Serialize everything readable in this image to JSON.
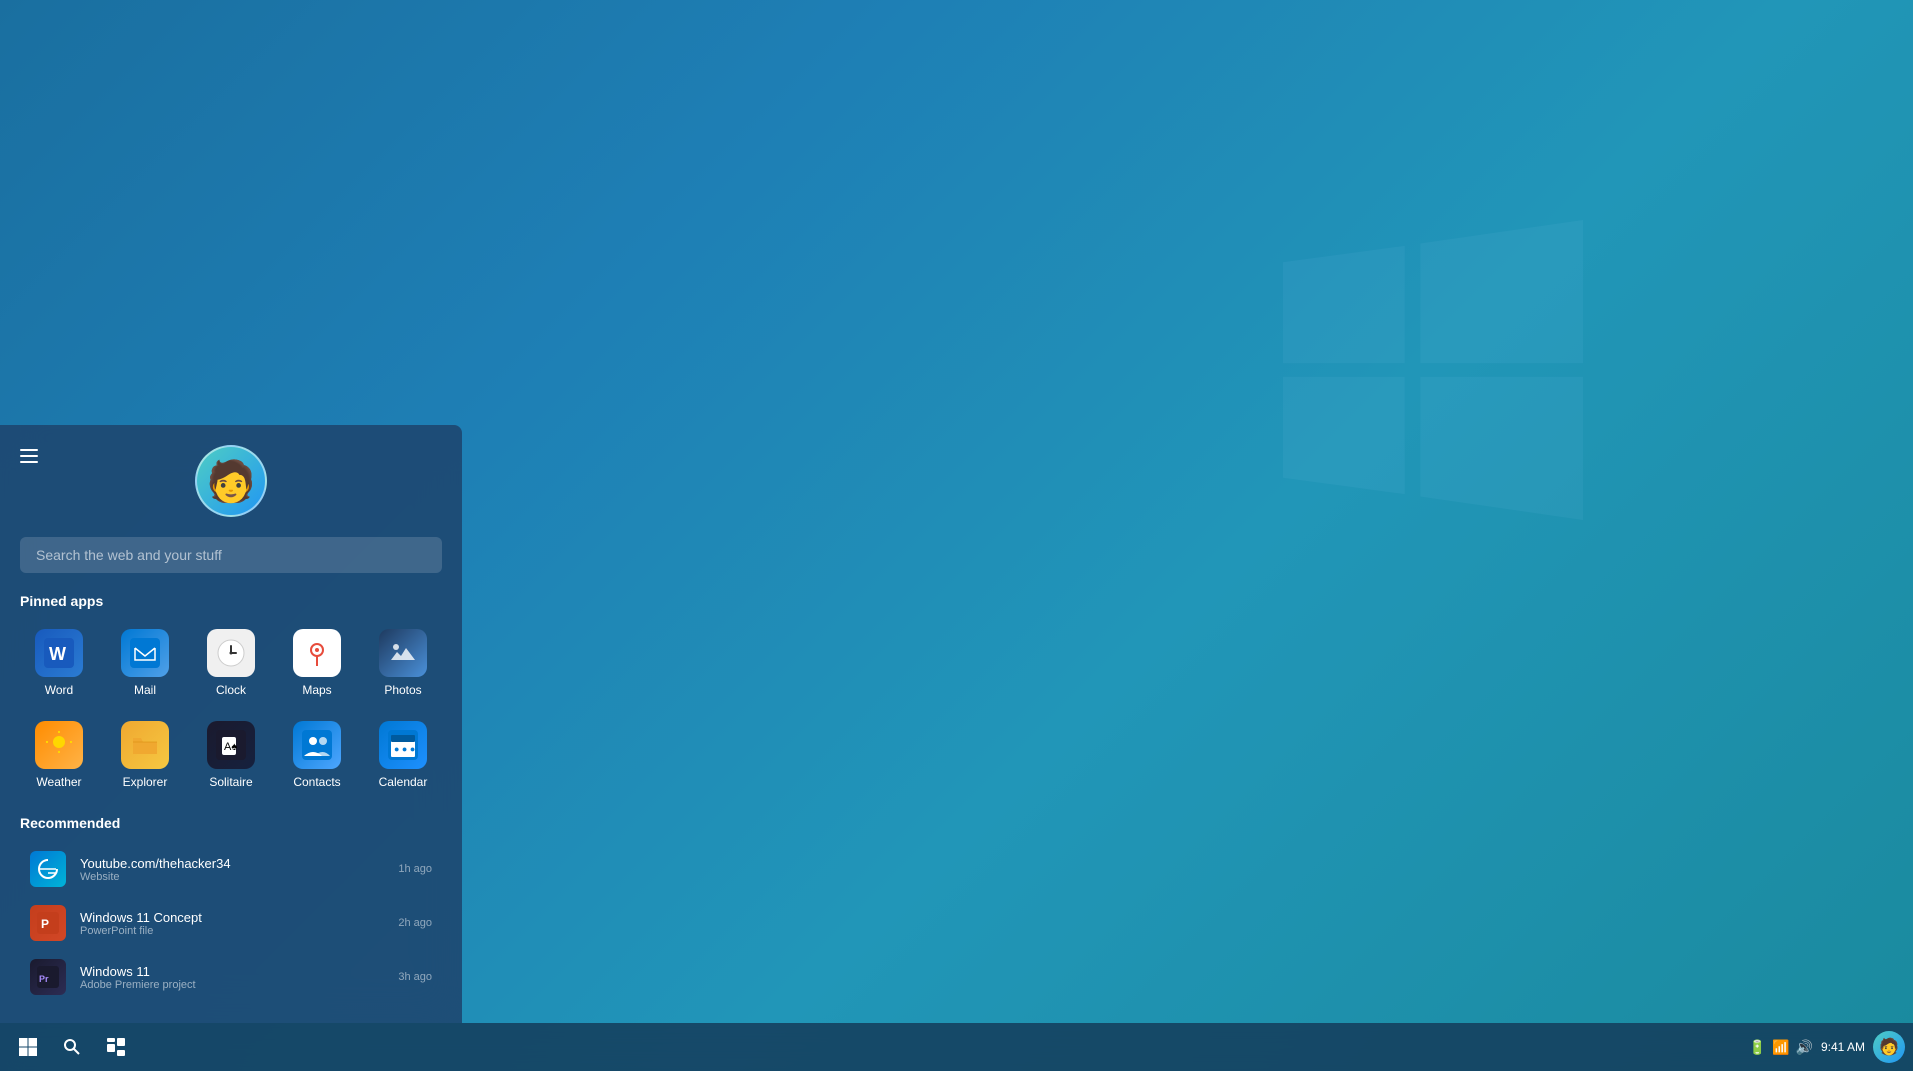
{
  "desktop": {
    "background": "teal-blue gradient"
  },
  "start_menu": {
    "search_placeholder": "Search the web and your stuff",
    "pinned_label": "Pinned apps",
    "recommended_label": "Recommended",
    "pinned_apps": [
      {
        "id": "word",
        "label": "Word",
        "icon_class": "icon-word",
        "icon": "W"
      },
      {
        "id": "mail",
        "label": "Mail",
        "icon_class": "icon-mail",
        "icon": "✉"
      },
      {
        "id": "clock",
        "label": "Clock",
        "icon_class": "icon-clock",
        "icon": "🕐"
      },
      {
        "id": "maps",
        "label": "Maps",
        "icon_class": "icon-maps",
        "icon": "📍"
      },
      {
        "id": "photos",
        "label": "Photos",
        "icon_class": "icon-photos",
        "icon": "🏔"
      },
      {
        "id": "weather",
        "label": "Weather",
        "icon_class": "icon-weather",
        "icon": "☀"
      },
      {
        "id": "explorer",
        "label": "Explorer",
        "icon_class": "icon-explorer",
        "icon": "📁"
      },
      {
        "id": "solitaire",
        "label": "Solitaire",
        "icon_class": "icon-solitaire",
        "icon": "🃏"
      },
      {
        "id": "contacts",
        "label": "Contacts",
        "icon_class": "icon-contacts",
        "icon": "👥"
      },
      {
        "id": "calendar",
        "label": "Calendar",
        "icon_class": "icon-calendar",
        "icon": "📅"
      }
    ],
    "recommended_items": [
      {
        "id": "youtube",
        "title": "Youtube.com/thehacker34",
        "subtitle": "Website",
        "time": "1h ago",
        "icon_class": "rec-icon-edge",
        "icon": "e"
      },
      {
        "id": "win11concept",
        "title": "Windows 11 Concept",
        "subtitle": "PowerPoint file",
        "time": "2h ago",
        "icon_class": "rec-icon-ppt",
        "icon": "P"
      },
      {
        "id": "win11",
        "title": "Windows 11",
        "subtitle": "Adobe Premiere project",
        "time": "3h ago",
        "icon_class": "rec-icon-pr",
        "icon": "Pr"
      }
    ]
  },
  "taskbar": {
    "time": "9:41 AM",
    "start_label": "Start",
    "search_label": "Search",
    "widgets_label": "Widgets"
  }
}
